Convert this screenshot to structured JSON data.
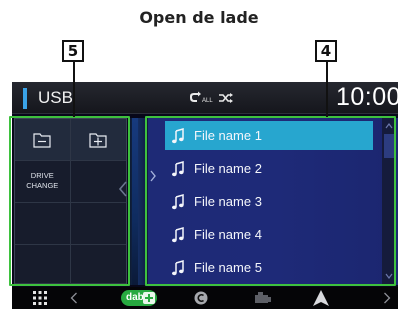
{
  "header": {
    "title": "Open de lade"
  },
  "callouts": {
    "left_panel": "5",
    "file_list": "4"
  },
  "status_bar": {
    "source": "USB",
    "repeat_icon": "repeat-all-icon",
    "shuffle_icon": "shuffle-icon",
    "time": "10:00"
  },
  "left_panel": {
    "buttons": [
      {
        "icon": "folder-minus-icon"
      },
      {
        "icon": "folder-plus-icon"
      },
      {
        "label": "DRIVE\nCHANGE"
      }
    ]
  },
  "file_list": {
    "items": [
      {
        "label": "File name 1",
        "selected": true
      },
      {
        "label": "File name 2",
        "selected": false
      },
      {
        "label": "File name 3",
        "selected": false
      },
      {
        "label": "File name 4",
        "selected": false
      },
      {
        "label": "File name 5",
        "selected": false
      }
    ]
  },
  "nav_bar": {
    "items": [
      {
        "icon": "grid-menu-icon"
      },
      {
        "icon": "back-triangle-icon"
      },
      {
        "icon": "dab-plus-icon",
        "label": "dab"
      },
      {
        "icon": "circle-c-icon"
      },
      {
        "icon": "camera-icon"
      },
      {
        "icon": "navigation-arrow-icon"
      },
      {
        "icon": "forward-triangle-icon"
      }
    ]
  },
  "colors": {
    "callout": "#3ec13e",
    "selection": "#27a6cf",
    "list_background": "#1e2a78",
    "source_accent": "#3aa3e8",
    "dab_green": "#27a940"
  }
}
